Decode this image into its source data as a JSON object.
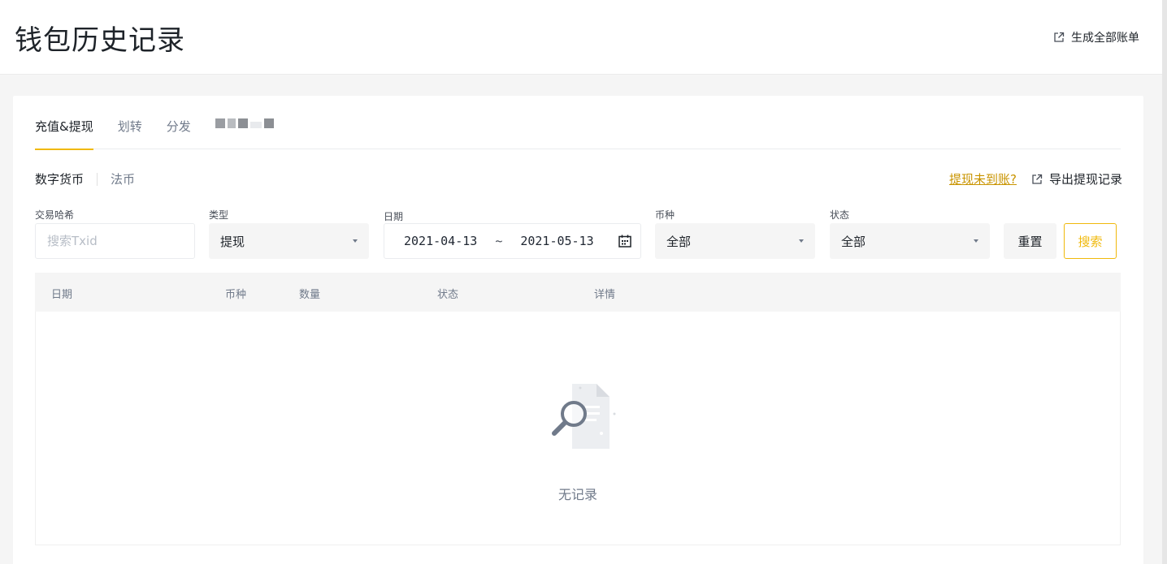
{
  "header": {
    "title": "钱包历史记录",
    "generate_bill_label": "生成全部账单"
  },
  "tabs": [
    {
      "label": "充值&提现",
      "active": true
    },
    {
      "label": "划转",
      "active": false
    },
    {
      "label": "分发",
      "active": false
    }
  ],
  "subtabs": [
    {
      "label": "数字货币",
      "active": true
    },
    {
      "label": "法币",
      "active": false
    }
  ],
  "links": {
    "not_arrived": "提现未到账?",
    "export": "导出提现记录"
  },
  "filters": {
    "txid": {
      "label": "交易哈希",
      "placeholder": "搜索Txid",
      "value": ""
    },
    "type": {
      "label": "类型",
      "value": "提现"
    },
    "date": {
      "label": "日期",
      "start": "2021-04-13",
      "separator": "~",
      "end": "2021-05-13"
    },
    "coin": {
      "label": "币种",
      "value": "全部"
    },
    "status": {
      "label": "状态",
      "value": "全部"
    }
  },
  "buttons": {
    "reset": "重置",
    "search": "搜索"
  },
  "table": {
    "columns": [
      "日期",
      "币种",
      "数量",
      "状态",
      "详情"
    ],
    "rows": [],
    "empty_text": "无记录"
  },
  "colors": {
    "accent": "#f0b90b",
    "link": "#c99400",
    "text": "#1e2329",
    "muted": "#707a8a"
  }
}
